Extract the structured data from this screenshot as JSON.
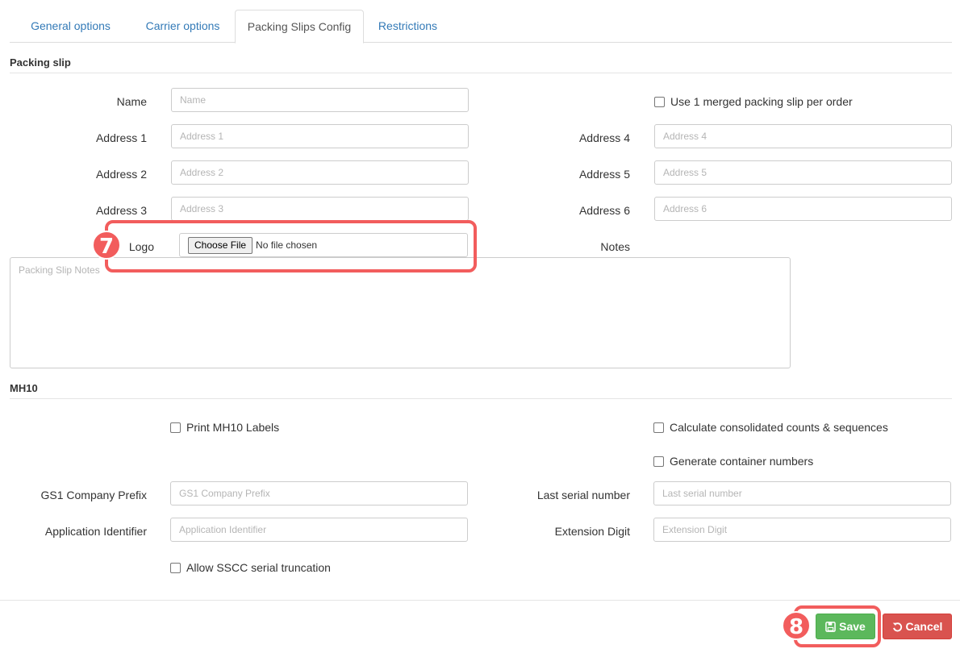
{
  "tabs": [
    {
      "label": "General options",
      "active": false
    },
    {
      "label": "Carrier options",
      "active": false
    },
    {
      "label": "Packing Slips Config",
      "active": true
    },
    {
      "label": "Restrictions",
      "active": false
    }
  ],
  "packing_slip": {
    "title": "Packing slip",
    "name": {
      "label": "Name",
      "placeholder": "Name",
      "value": ""
    },
    "address1": {
      "label": "Address 1",
      "placeholder": "Address 1",
      "value": ""
    },
    "address2": {
      "label": "Address 2",
      "placeholder": "Address 2",
      "value": ""
    },
    "address3": {
      "label": "Address 3",
      "placeholder": "Address 3",
      "value": ""
    },
    "address4": {
      "label": "Address 4",
      "placeholder": "Address 4",
      "value": ""
    },
    "address5": {
      "label": "Address 5",
      "placeholder": "Address 5",
      "value": ""
    },
    "address6": {
      "label": "Address 6",
      "placeholder": "Address 6",
      "value": ""
    },
    "merged_checkbox": {
      "label": "Use 1 merged packing slip per order",
      "checked": false
    },
    "logo": {
      "label": "Logo",
      "button": "Choose File",
      "status": "No file chosen"
    },
    "notes": {
      "label": "Notes",
      "placeholder": "Packing Slip Notes",
      "value": ""
    }
  },
  "mh10": {
    "title": "MH10",
    "print_labels": {
      "label": "Print MH10 Labels",
      "checked": false
    },
    "consolidated": {
      "label": "Calculate consolidated counts & sequences",
      "checked": false
    },
    "generate_containers": {
      "label": "Generate container numbers",
      "checked": false
    },
    "gs1_prefix": {
      "label": "GS1 Company Prefix",
      "placeholder": "GS1 Company Prefix",
      "value": ""
    },
    "last_serial": {
      "label": "Last serial number",
      "placeholder": "Last serial number",
      "value": ""
    },
    "app_identifier": {
      "label": "Application Identifier",
      "placeholder": "Application Identifier",
      "value": ""
    },
    "extension_digit": {
      "label": "Extension Digit",
      "placeholder": "Extension Digit",
      "value": ""
    },
    "allow_truncation": {
      "label": "Allow SSCC serial truncation",
      "checked": false
    }
  },
  "footer": {
    "save_label": "Save",
    "cancel_label": "Cancel"
  },
  "annotations": {
    "logo_step": "7",
    "save_step": "8",
    "highlight_color": "#f25d5d"
  },
  "colors": {
    "tab_link": "#337ab7",
    "save_green": "#5cb85c",
    "cancel_red": "#d9534f"
  }
}
